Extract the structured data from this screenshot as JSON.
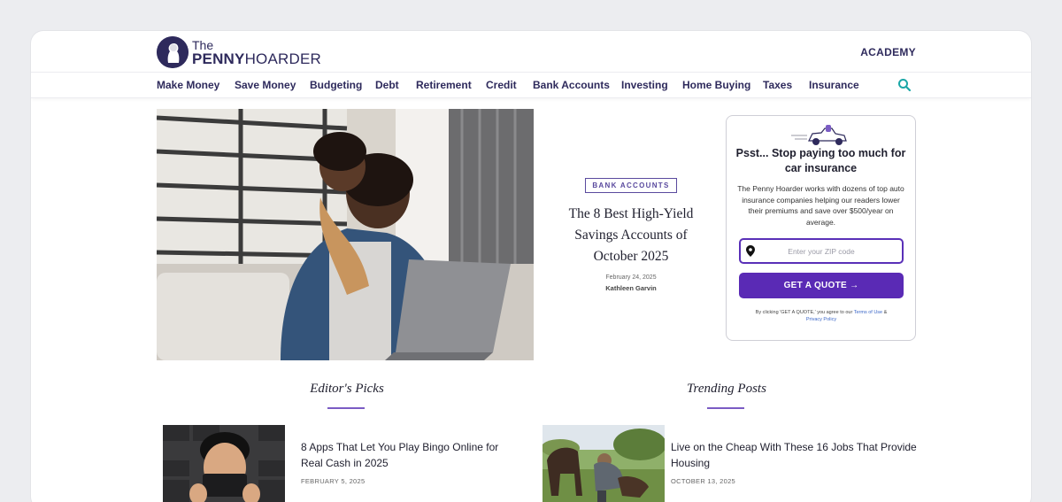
{
  "header": {
    "logo_the": "The",
    "logo_penny": "PENNY",
    "logo_hoarder": "HOARDER",
    "academy_link": "ACADEMY"
  },
  "nav": {
    "items": [
      "Make Money",
      "Save Money",
      "Budgeting",
      "Debt",
      "Retirement",
      "Credit",
      "Bank Accounts",
      "Investing",
      "Home Buying",
      "Taxes",
      "Insurance"
    ],
    "search_icon": "search-icon"
  },
  "hero": {
    "category": "BANK ACCOUNTS",
    "title": "The 8 Best High-Yield Savings Accounts of October 2025",
    "date": "February 24, 2025",
    "author": "Kathleen Garvin"
  },
  "widget": {
    "title": "Psst... Stop paying too much for car insurance",
    "description": "The Penny Hoarder works with dozens of top auto insurance companies helping our readers lower their premiums and save over $500/year on average.",
    "zip_placeholder": "Enter your ZIP code",
    "button_label": "GET A QUOTE",
    "fine_print_prefix": "By clicking 'GET A QUOTE,' you agree to our",
    "terms_link": "Terms of Use",
    "fine_print_and": "&",
    "privacy_link": "Privacy Policy"
  },
  "sections": {
    "editors_picks": {
      "title": "Editor's Picks",
      "card": {
        "title": "8 Apps That Let You Play Bingo Online for Real Cash in 2025",
        "date": "FEBRUARY 5, 2025"
      }
    },
    "trending": {
      "title": "Trending Posts",
      "card": {
        "title": "Live on the Cheap With These 16 Jobs That Provide Housing",
        "date": "OCTOBER 13, 2025"
      }
    }
  },
  "colors": {
    "brand_navy": "#2e2a5c",
    "accent_purple": "#5a2ab5",
    "search_teal": "#1aa7a7"
  }
}
